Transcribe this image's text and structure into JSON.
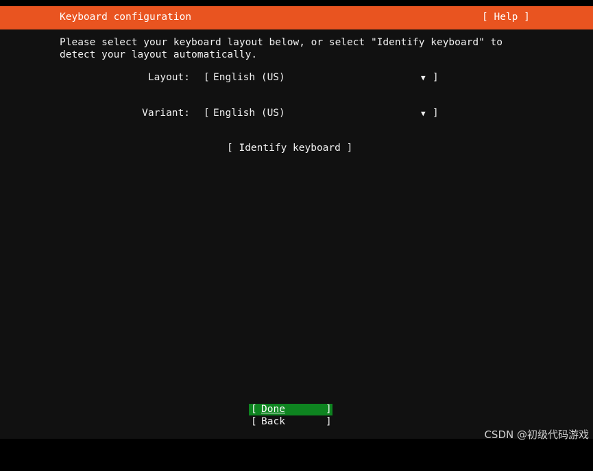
{
  "header": {
    "title": "Keyboard configuration",
    "help_label": "[ Help ]"
  },
  "intro": {
    "text": "Please select your keyboard layout below, or select \"Identify keyboard\" to\ndetect your layout automatically."
  },
  "fields": {
    "layout": {
      "label": "Layout:",
      "open": "[",
      "value": "English (US)",
      "arrow": "▼",
      "close": "]"
    },
    "variant": {
      "label": "Variant:",
      "open": "[",
      "value": "English (US)",
      "arrow": "▼",
      "close": "]"
    }
  },
  "identify_button": {
    "label": "[ Identify keyboard ]"
  },
  "buttons": {
    "done": {
      "open": "[",
      "label": "Done",
      "close": "]"
    },
    "back": {
      "open": "[",
      "label": "Back",
      "close": "]"
    }
  },
  "watermark": {
    "text": "CSDN @初级代码游戏"
  },
  "colors": {
    "header_bg": "#e95420",
    "screen_bg": "#111111",
    "focused_button_bg": "#0e8420",
    "text": "#f0f0f0"
  }
}
